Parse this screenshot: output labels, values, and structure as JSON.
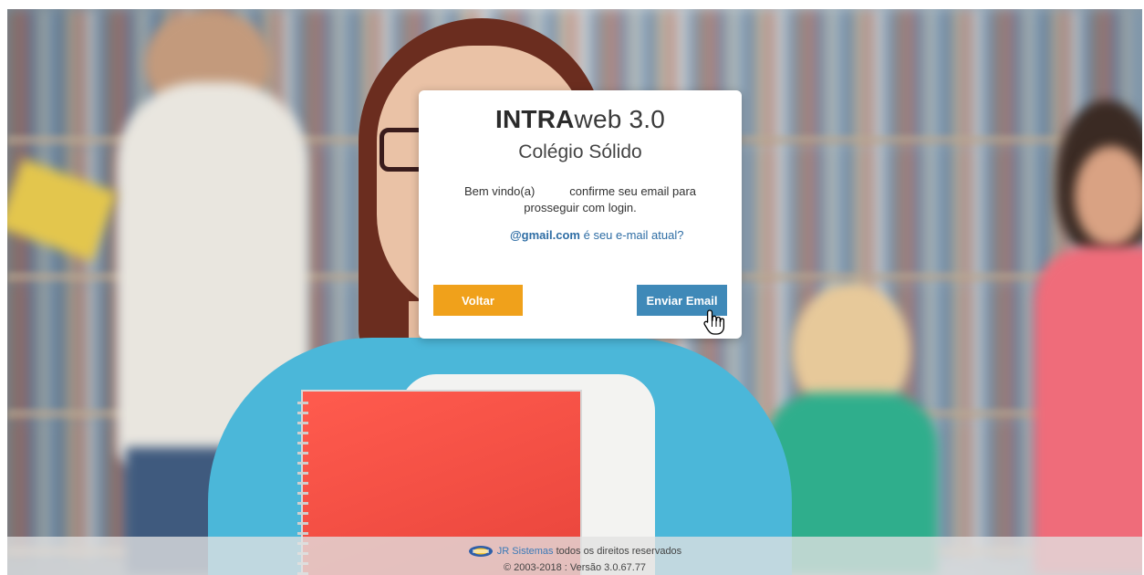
{
  "card": {
    "brand_bold": "INTRA",
    "brand_rest": "web 3.0",
    "school": "Colégio Sólido",
    "message_part1": "Bem vindo(a)",
    "message_part2": "confirme seu email para prosseguir com login.",
    "email_domain": "@gmail.com",
    "email_question": " é seu e-mail atual?"
  },
  "buttons": {
    "back_label": "Voltar",
    "send_label": "Enviar Email"
  },
  "footer": {
    "company": "JR Sistemas",
    "rights": " todos os direitos reservados",
    "version": "© 2003-2018 : Versão 3.0.67.77"
  },
  "colors": {
    "back_button": "#f0a11b",
    "send_button": "#3f89b8",
    "link": "#2e6da4"
  },
  "icons": {
    "cursor": "hand-pointer-icon",
    "footer_logo": "jr-sistemas-logo"
  }
}
